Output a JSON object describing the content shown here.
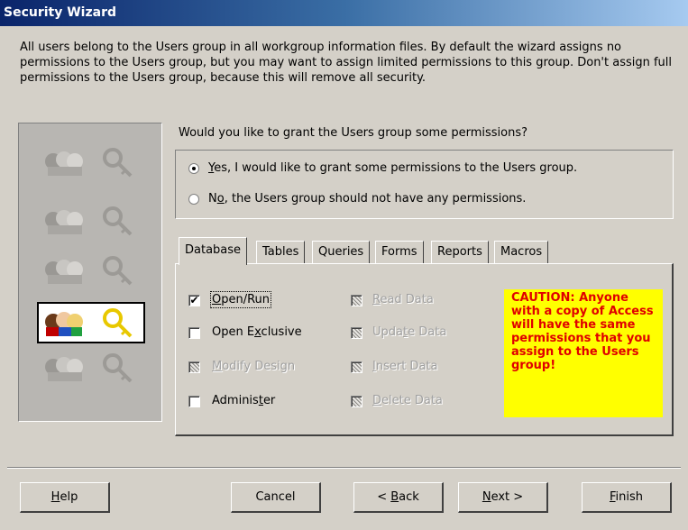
{
  "window": {
    "title": "Security Wizard"
  },
  "intro": "All users belong to the Users group in all workgroup information files. By default the wizard assigns no permissions to the Users group, but you may want to assign limited permissions to this group. Don't assign full permissions to the Users group, because this will remove all security.",
  "question": "Would you like to grant the Users group some permissions?",
  "options": [
    {
      "pre": "",
      "key": "Y",
      "post": "es, I would like to grant some permissions to the Users group.",
      "selected": true
    },
    {
      "pre": "N",
      "key": "o",
      "post": ", the Users group should not have any permissions.",
      "selected": false
    }
  ],
  "tabs": [
    "Database",
    "Tables",
    "Queries",
    "Forms",
    "Reports",
    "Macros"
  ],
  "active_tab": "Database",
  "permissions": {
    "open_run": {
      "pre": "",
      "key": "O",
      "post": "pen/Run",
      "checked": true,
      "enabled": true
    },
    "open_exclusive": {
      "pre": "Open E",
      "key": "x",
      "post": "clusive",
      "checked": false,
      "enabled": true
    },
    "modify_design": {
      "pre": "",
      "key": "M",
      "post": "odify Design",
      "checked": false,
      "enabled": false
    },
    "administer": {
      "pre": "Adminis",
      "key": "t",
      "post": "er",
      "checked": false,
      "enabled": true
    },
    "read_data": {
      "pre": "",
      "key": "R",
      "post": "ead Data",
      "enabled": false
    },
    "update_data": {
      "pre": "Upda",
      "key": "t",
      "post": "e Data",
      "enabled": false
    },
    "insert_data": {
      "pre": "",
      "key": "I",
      "post": "nsert Data",
      "enabled": false
    },
    "delete_data": {
      "pre": "",
      "key": "D",
      "post": "elete Data",
      "enabled": false
    }
  },
  "caution": "CAUTION: Anyone with a copy of Access will have the same permissions that you assign to the Users group!",
  "buttons": {
    "help": {
      "pre": "",
      "key": "H",
      "post": "elp"
    },
    "cancel": "Cancel",
    "back": {
      "pre": "< ",
      "key": "B",
      "post": "ack"
    },
    "next": {
      "pre": "",
      "key": "N",
      "post": "ext >"
    },
    "finish": {
      "pre": "",
      "key": "F",
      "post": "inish"
    }
  },
  "icons": [
    "users-group-icon",
    "key-icon"
  ],
  "colors": {
    "caution_bg": "#ffff00",
    "caution_text": "#e00000",
    "title_bar": "#0a246a"
  }
}
